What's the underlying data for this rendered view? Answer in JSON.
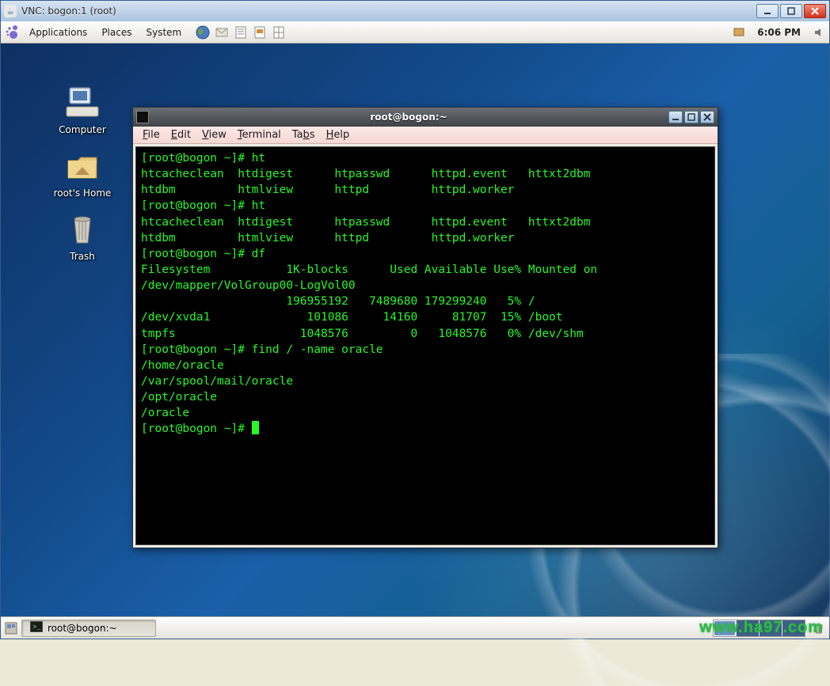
{
  "vnc": {
    "title": "VNC: bogon:1 (root)"
  },
  "gnome_panel": {
    "menus": [
      "Applications",
      "Places",
      "System"
    ],
    "clock": "6:06 PM"
  },
  "desktop_icons": {
    "computer": "Computer",
    "home": "root's Home",
    "trash": "Trash"
  },
  "bottom_panel": {
    "task": "root@bogon:~"
  },
  "terminal": {
    "title": "root@bogon:~",
    "menus": [
      "File",
      "Edit",
      "View",
      "Terminal",
      "Tabs",
      "Help"
    ],
    "lines": [
      "[root@bogon ~]# ht",
      "htcacheclean  htdigest      htpasswd      httpd.event   httxt2dbm",
      "htdbm         htmlview      httpd         httpd.worker",
      "[root@bogon ~]# ht",
      "htcacheclean  htdigest      htpasswd      httpd.event   httxt2dbm",
      "htdbm         htmlview      httpd         httpd.worker",
      "[root@bogon ~]# df",
      "Filesystem           1K-blocks      Used Available Use% Mounted on",
      "/dev/mapper/VolGroup00-LogVol00",
      "                     196955192   7489680 179299240   5% /",
      "/dev/xvda1              101086     14160     81707  15% /boot",
      "tmpfs                  1048576         0   1048576   0% /dev/shm",
      "[root@bogon ~]# find / -name oracle",
      "/home/oracle",
      "/var/spool/mail/oracle",
      "/opt/oracle",
      "/oracle",
      "[root@bogon ~]# "
    ]
  },
  "watermark": "www.ha97.com"
}
